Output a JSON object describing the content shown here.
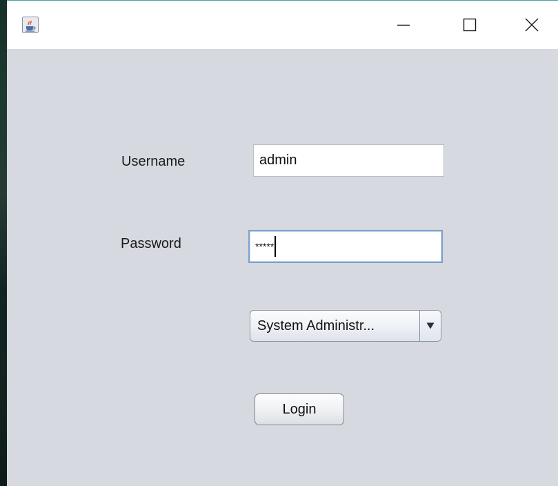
{
  "window": {
    "title": "",
    "controls": {
      "minimize_icon": "minimize-icon",
      "maximize_icon": "maximize-icon",
      "close_icon": "close-icon"
    },
    "app_icon": "java-coffee-icon"
  },
  "form": {
    "username_label": "Username",
    "username_value": "admin",
    "password_label": "Password",
    "password_masked": "*****",
    "role_selected": "System Administr...",
    "login_label": "Login"
  },
  "colors": {
    "background": "#d6d9df",
    "titlebar": "#ffffff",
    "focus_border": "#7da2ce",
    "window_accent": "#3aa7a0"
  }
}
